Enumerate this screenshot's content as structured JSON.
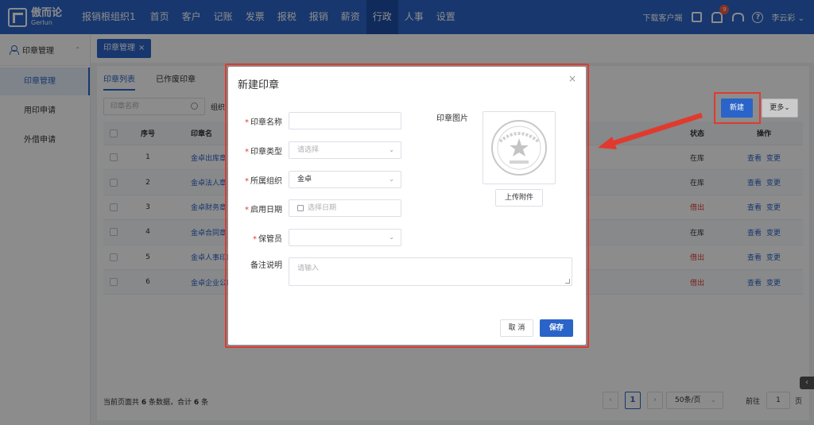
{
  "header": {
    "logo_cn": "傲而论",
    "logo_en": "Gerlun",
    "org": "报销根组织1",
    "nav": [
      "首页",
      "客户",
      "记账",
      "发票",
      "报税",
      "报销",
      "薪资",
      "行政",
      "人事",
      "设置"
    ],
    "active_nav": "行政",
    "download": "下载客户端",
    "notif_count": "9",
    "user": "李云彩"
  },
  "sidebar": {
    "title": "印章管理",
    "items": [
      "印章管理",
      "用印申请",
      "外借申请"
    ]
  },
  "page_tab": "印章管理",
  "subtabs": [
    "印章列表",
    "已作废印章"
  ],
  "toolbar": {
    "search_placeholder": "印章名称",
    "org_label": "组织",
    "new": "新建",
    "more": "更多"
  },
  "table": {
    "headers": [
      "序号",
      "印章名",
      "状态",
      "操作"
    ],
    "rows": [
      {
        "no": "1",
        "name": "金卓出库章",
        "status": "在库",
        "out": false
      },
      {
        "no": "2",
        "name": "金卓法人章",
        "status": "在库",
        "out": false
      },
      {
        "no": "3",
        "name": "金卓财务章",
        "status": "借出",
        "out": true
      },
      {
        "no": "4",
        "name": "金卓合同章",
        "status": "在库",
        "out": false
      },
      {
        "no": "5",
        "name": "金卓人事印章",
        "status": "借出",
        "out": true
      },
      {
        "no": "6",
        "name": "金卓企业公章",
        "status": "借出",
        "out": true
      }
    ],
    "op_view": "查看",
    "op_change": "变更"
  },
  "pagination": {
    "summary_a": "当前页面共",
    "summary_count": "6",
    "summary_b": "条数据，合计",
    "summary_total": "6",
    "summary_c": "条",
    "page": "1",
    "page_size": "50条/页",
    "goto_label": "前往",
    "goto_value": "1",
    "goto_unit": "页"
  },
  "modal": {
    "title": "新建印章",
    "fields": {
      "name_label": "印章名称",
      "type_label": "印章类型",
      "type_placeholder": "请选择",
      "org_label": "所属组织",
      "org_value": "金卓",
      "date_label": "启用日期",
      "date_placeholder": "选择日期",
      "keeper_label": "保管员",
      "note_label": "备注说明",
      "note_placeholder": "请输入"
    },
    "image_label": "印章图片",
    "upload": "上传附件",
    "cancel": "取 消",
    "save": "保存"
  },
  "colors": {
    "primary": "#2a64c8",
    "danger": "#e03a2f"
  }
}
